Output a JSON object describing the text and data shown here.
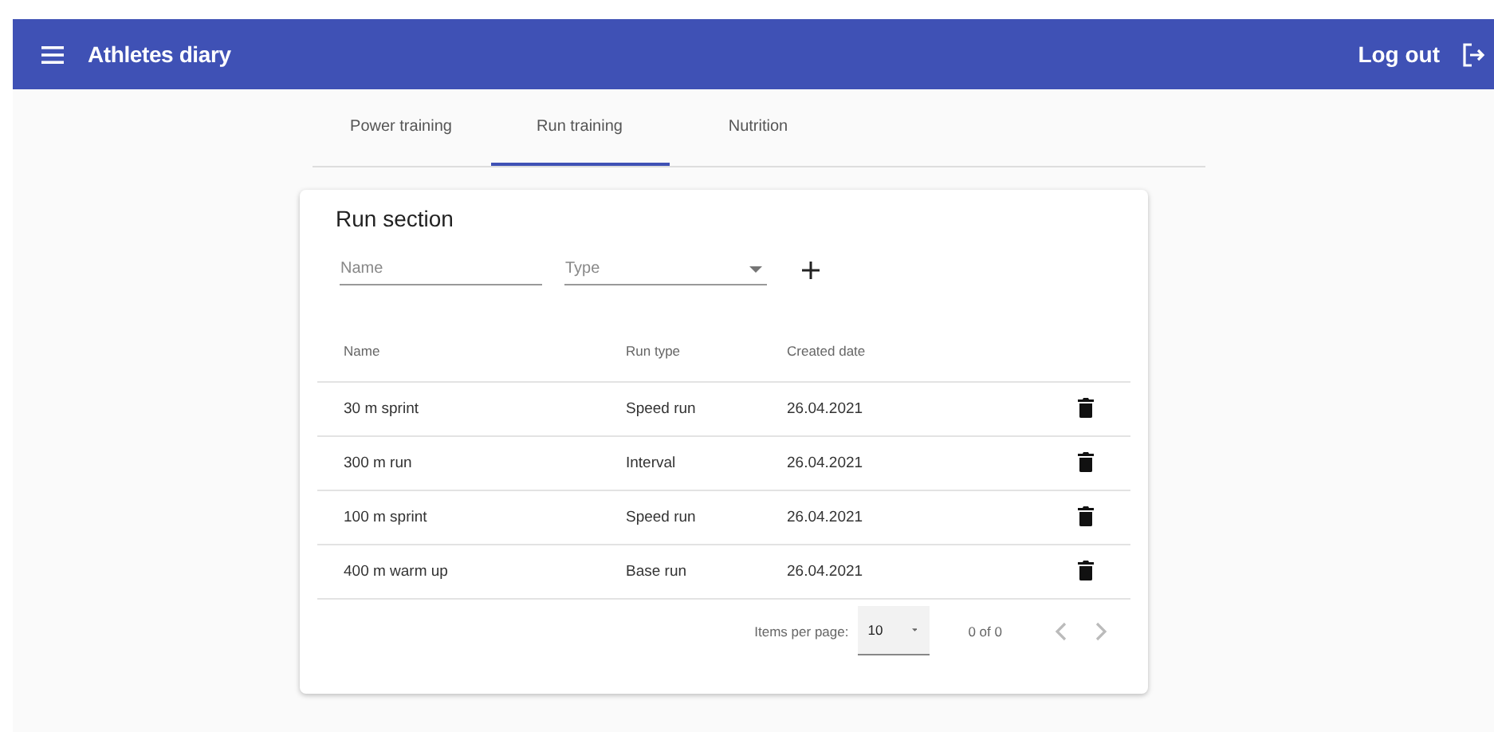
{
  "toolbar": {
    "title": "Athletes diary",
    "logout": "Log out"
  },
  "tabs": [
    {
      "label": "Power training",
      "selected": false
    },
    {
      "label": "Run training",
      "selected": true
    },
    {
      "label": "Nutrition",
      "selected": false
    }
  ],
  "card": {
    "title": "Run section",
    "filters": {
      "name_placeholder": "Name",
      "type_placeholder": "Type"
    },
    "table": {
      "columns": [
        "Name",
        "Run type",
        "Created date"
      ],
      "rows": [
        {
          "name": "30 m sprint",
          "type": "Speed run",
          "date": "26.04.2021"
        },
        {
          "name": "300 m run",
          "type": "Interval",
          "date": "26.04.2021"
        },
        {
          "name": "100 m sprint",
          "type": "Speed run",
          "date": "26.04.2021"
        },
        {
          "name": "400 m warm up",
          "type": "Base run",
          "date": "26.04.2021"
        }
      ]
    },
    "paginator": {
      "label": "Items per page:",
      "page_size": "10",
      "range": "0 of 0",
      "prev_disabled": true,
      "next_disabled": true
    }
  }
}
